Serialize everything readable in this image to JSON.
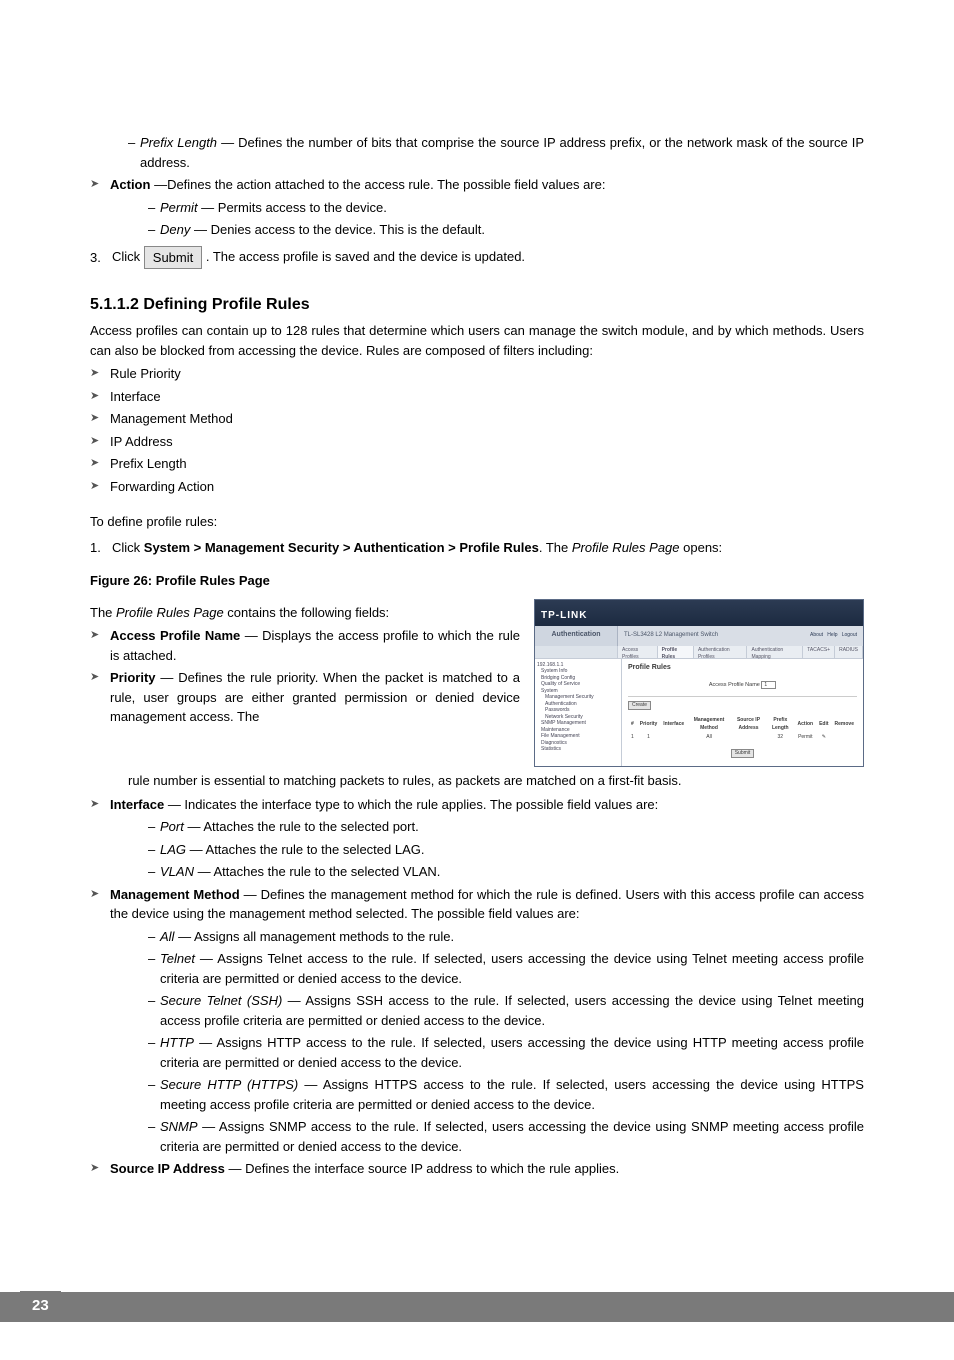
{
  "intro": {
    "prefixLength": {
      "term": "Prefix Length",
      "desc": " — Defines the number of bits that comprise the source IP address prefix, or the network mask of the source IP address."
    },
    "action": {
      "term": "Action",
      "desc": " —Defines the action attached to the access rule. The possible field values are:"
    },
    "permit": {
      "term": "Permit",
      "desc": " — Permits access to the device."
    },
    "deny": {
      "term": "Deny",
      "desc": " — Denies access to the device. This is the default."
    },
    "step3a": "3.",
    "step3b": "Click ",
    "submitLabel": "Submit",
    "step3c": ". The access profile is saved and the device is updated."
  },
  "section": {
    "heading": "5.1.1.2   Defining Profile Rules",
    "para": "Access profiles can contain up to 128 rules that determine which users can manage the switch module, and by which methods. Users can also be blocked from accessing the device. Rules are composed of filters including:",
    "bullets": [
      "Rule Priority",
      "Interface",
      "Management Method",
      "IP Address",
      "Prefix Length",
      "Forwarding Action"
    ],
    "toDefine": "To define profile rules:",
    "step1a": "Click ",
    "step1b": "System > Management Security > Authentication > Profile Rules",
    "step1c": ". The ",
    "step1d": "Profile Rules Page",
    "step1e": " opens:"
  },
  "figure": {
    "title": "Figure 26: Profile Rules Page",
    "lead": "The ",
    "leadEm": "Profile Rules Page",
    "leadEnd": " contains the following fields:"
  },
  "fields": {
    "apn": {
      "term": "Access Profile Name",
      "desc": " — Displays the access profile to which the rule is attached."
    },
    "priority": {
      "term": "Priority",
      "desc": " — Defines the rule priority. When the packet is matched to a rule, user groups are either granted permission or denied device management access. The rule number is essential to matching packets to rules, as packets are matched on a first-fit basis."
    },
    "interface": {
      "term": "Interface",
      "desc": " — Indicates the interface type to which the rule applies. The possible field values are:"
    },
    "ifPort": {
      "term": "Port",
      "desc": " — Attaches the rule to the selected port."
    },
    "ifLag": {
      "term": "LAG",
      "desc": " — Attaches the rule to the selected LAG."
    },
    "ifVlan": {
      "term": "VLAN",
      "desc": " — Attaches the rule to the selected VLAN."
    },
    "mm": {
      "term": "Management Method",
      "desc": " — Defines the management method for which the rule is defined. Users with this access profile can access the device using the management method selected. The possible field values are:"
    },
    "mmAll": {
      "term": "All",
      "desc": " — Assigns all management methods to the rule."
    },
    "mmTelnet": {
      "term": "Telnet",
      "desc": " — Assigns Telnet access to the rule. If selected, users accessing the device using Telnet meeting access profile criteria are permitted or denied access to the device."
    },
    "mmSsh": {
      "term": "Secure Telnet (SSH)",
      "desc": " — Assigns SSH access to the rule. If selected, users accessing the device using Telnet meeting access profile criteria are permitted or denied access to the device."
    },
    "mmHttp": {
      "term": "HTTP",
      "desc": " — Assigns HTTP access to the rule. If selected, users accessing the device using HTTP meeting access profile criteria are permitted or denied access to the device."
    },
    "mmHttps": {
      "term": "Secure HTTP (HTTPS)",
      "desc": " — Assigns HTTPS access to the rule. If selected, users accessing the device using HTTPS meeting access profile criteria are permitted or denied access to the device."
    },
    "mmSnmp": {
      "term": "SNMP",
      "desc": " — Assigns SNMP access to the rule. If selected, users accessing the device using SNMP meeting access profile criteria are permitted or denied access to the device."
    },
    "sip": {
      "term": "Source IP Address",
      "desc": " — Defines the interface source IP address to which the rule applies."
    }
  },
  "screenshot": {
    "brand": "TP-LINK",
    "auth": "Authentication",
    "device": "TL-SL3428 L2 Management Switch",
    "links": {
      "about": "About",
      "help": "Help",
      "logout": "Logout"
    },
    "tabs": [
      "Access Profiles",
      "Profile Rules",
      "Authentication Profiles",
      "Authentication Mapping",
      "TACACS+",
      "RADIUS"
    ],
    "tree": [
      "192.168.1.1",
      "System Info",
      "Bridging Config",
      "Quality of Service",
      "System",
      "Management Security",
      "Authentication",
      "Passwords",
      "Network Security",
      "SNMP Management",
      "Maintenance",
      "File Management",
      "Diagnostics",
      "Statistics"
    ],
    "panel": {
      "title": "Profile Rules",
      "fieldLabel": "Access Profile Name",
      "fieldValue": "1",
      "create": "Create",
      "cols": [
        "#",
        "Priority",
        "Interface",
        "Management Method",
        "Source IP Address",
        "Prefix Length",
        "Action",
        "Edit",
        "Remove"
      ],
      "row": [
        "1",
        "1",
        "",
        "All",
        "",
        "32",
        "Permit",
        "✎",
        ""
      ],
      "submit": "Submit"
    }
  },
  "pageNumber": "23"
}
